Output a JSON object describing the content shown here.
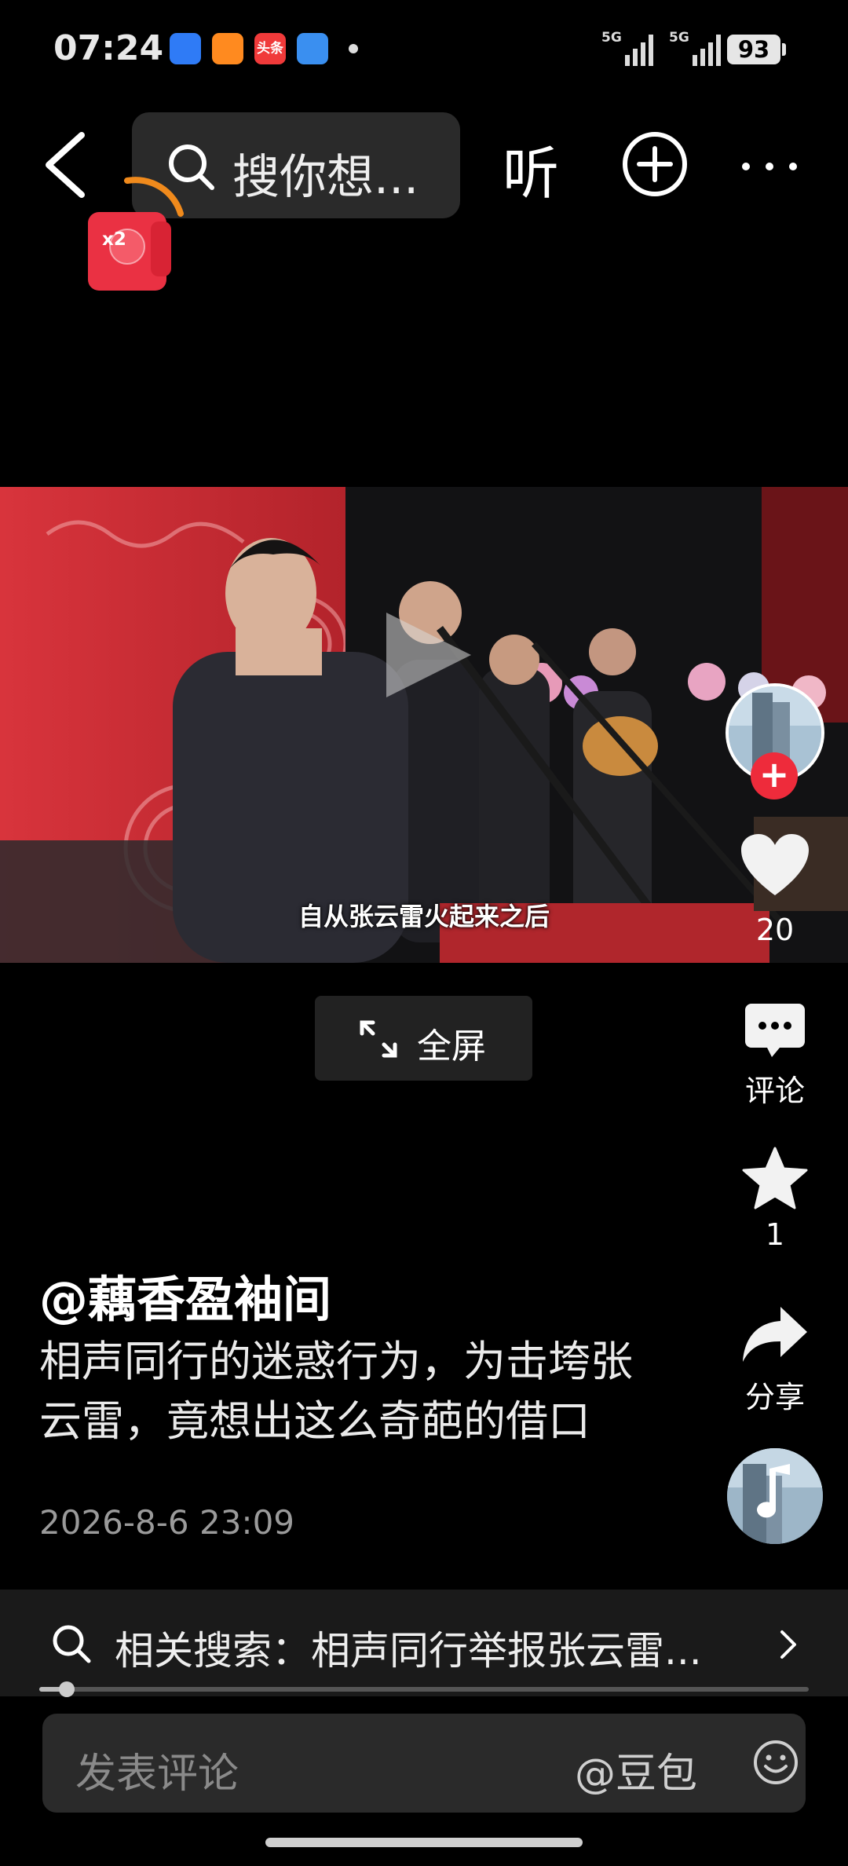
{
  "status_bar": {
    "time": "07:24",
    "app_icons": [
      {
        "name": "browser-app-icon",
        "color": "#2f7bf6",
        "label": ""
      },
      {
        "name": "video-app-icon",
        "color": "#ff8a1f",
        "label": ""
      },
      {
        "name": "toutiao-app-icon",
        "color": "#f03a3a",
        "label": "头条"
      },
      {
        "name": "weather-app-icon",
        "color": "#3a8ff0",
        "label": ""
      }
    ],
    "signal1_label": "5G",
    "signal2_label": "5G",
    "battery": "93"
  },
  "top_bar": {
    "search_placeholder": "搜你想...",
    "listen_label": "听"
  },
  "red_packet": {
    "multiplier": "x2"
  },
  "video": {
    "subtitle": "自从张云雷火起来之后"
  },
  "fullscreen_label": "全屏",
  "rail": {
    "like_count": "20",
    "comment_label": "评论",
    "favorite_count": "1",
    "share_label": "分享"
  },
  "post": {
    "author": "@藕香盈袖间",
    "description": "相声同行的迷惑行为，为击垮张云雷，竟想出这么奇葩的借口",
    "date": "2026-8-6 23:09"
  },
  "related_search": {
    "text": "相关搜索：相声同行举报张云雷..."
  },
  "progress": {
    "fraction": 0.03
  },
  "comment_bar": {
    "placeholder": "发表评论",
    "mention": "@豆包"
  },
  "colors": {
    "accent_red": "#ee2b3b",
    "background": "#000000"
  }
}
